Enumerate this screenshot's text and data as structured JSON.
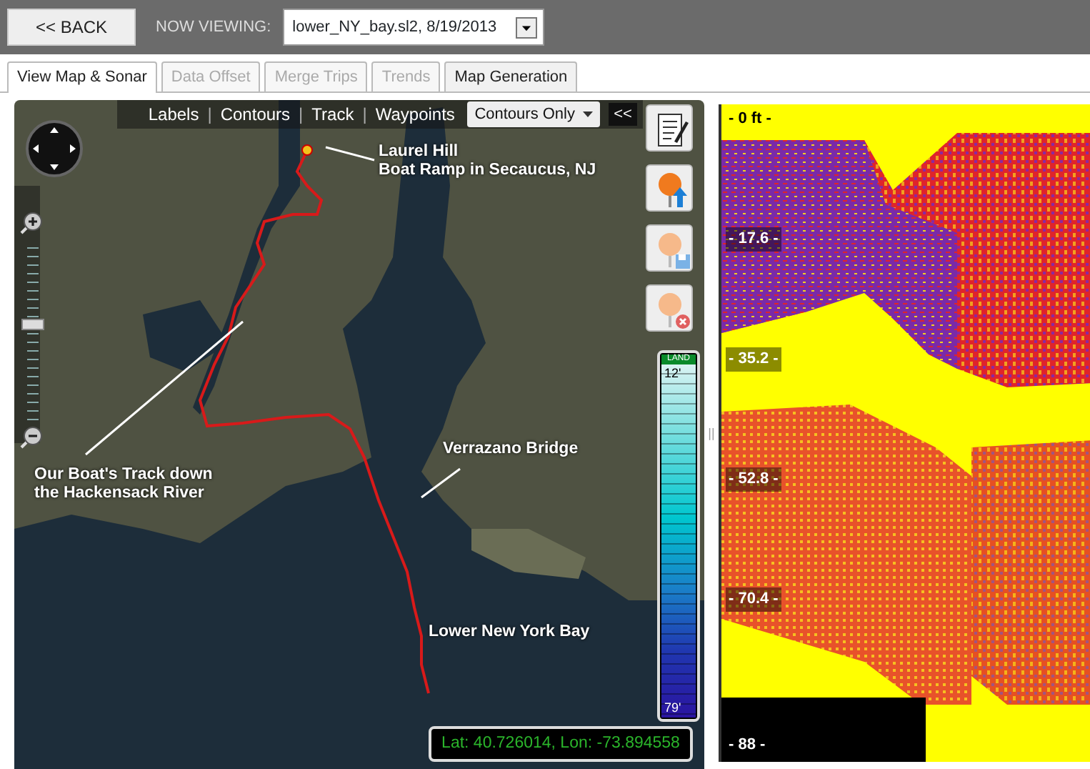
{
  "header": {
    "back_button": "<< BACK",
    "viewing_label": "NOW VIEWING:",
    "file_select": "lower_NY_bay.sl2, 8/19/2013"
  },
  "tabs": [
    {
      "label": "View Map & Sonar",
      "selected": true,
      "disabled": false
    },
    {
      "label": "Data Offset",
      "selected": false,
      "disabled": true
    },
    {
      "label": "Merge Trips",
      "selected": false,
      "disabled": true
    },
    {
      "label": "Trends",
      "selected": false,
      "disabled": true
    },
    {
      "label": "Map Generation",
      "selected": false,
      "disabled": false
    }
  ],
  "map": {
    "layer_links": [
      "Labels",
      "Contours",
      "Track",
      "Waypoints"
    ],
    "link_separator": "|",
    "splitter": "||",
    "layer_select": "Contours Only",
    "collapse_button": "<<",
    "zoom_slider": {
      "level": 0.55
    },
    "annotations": [
      {
        "text": "Laurel Hill\nBoat Ramp in Secaucus, NJ",
        "kind": "start"
      },
      {
        "text": "Our Boat's Track down\nthe Hackensack River",
        "kind": "track"
      },
      {
        "text": "Verrazano Bridge",
        "kind": "bridge"
      },
      {
        "text": "Lower New York Bay",
        "kind": "bay"
      }
    ],
    "depth_legend": {
      "land_label": "LAND",
      "min": "12'",
      "max": "79'"
    },
    "coordinates": "Lat: 40.726014, Lon: -73.894558"
  },
  "sonar": {
    "depth_labels": [
      "- 0 ft -",
      "- 17.6 -",
      "- 35.2 -",
      "- 52.8 -",
      "- 70.4 -",
      "- 88 -"
    ]
  }
}
